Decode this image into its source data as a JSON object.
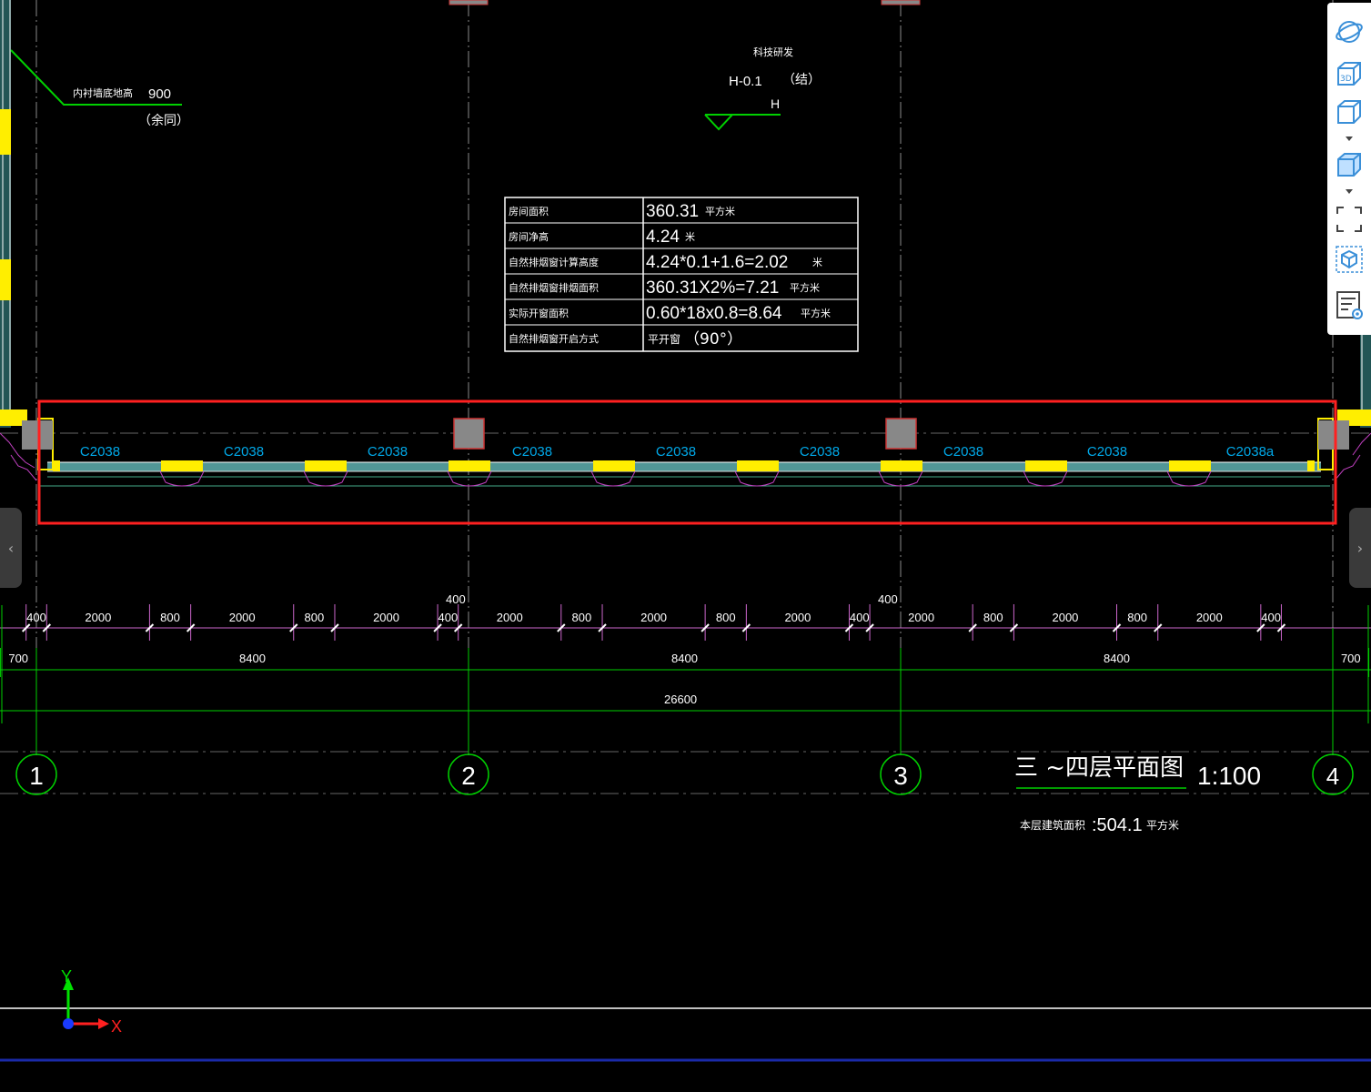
{
  "drawing": {
    "elevation": {
      "label": "科技研发",
      "value": "H-0.1",
      "note": "（结）",
      "h": "H"
    },
    "wall_note": {
      "label": "内衬墙底地高",
      "value": "900",
      "note": "（余同）"
    },
    "table": {
      "rows": [
        {
          "label": "房间面积",
          "value": "360.31",
          "unit": "平方米"
        },
        {
          "label": "房间净高",
          "value": "4.24",
          "unit": "米"
        },
        {
          "label": "自然排烟窗计算高度",
          "value": "4.24*0.1+1.6=2.02",
          "unit": "米"
        },
        {
          "label": "自然排烟窗排烟面积",
          "value": "360.31X2%=7.21",
          "unit": "平方米"
        },
        {
          "label": "实际开窗面积",
          "value": "0.60*18x0.8=8.64",
          "unit": "平方米"
        },
        {
          "label": "自然排烟窗开启方式",
          "value": "平开窗",
          "unit": "（90°）"
        }
      ]
    },
    "windows": [
      "C2038",
      "C2038",
      "C2038",
      "C2038",
      "C2038",
      "C2038",
      "C2038",
      "C2038",
      "C2038a"
    ],
    "dim_top_labels": [
      "400",
      "400"
    ],
    "dim_row1": [
      "400",
      "2000",
      "800",
      "2000",
      "800",
      "2000",
      "400",
      "2000",
      "800",
      "2000",
      "800",
      "2000",
      "400",
      "2000",
      "800",
      "2000",
      "800",
      "2000",
      "400"
    ],
    "dim_row2": [
      "700",
      "8400",
      "8400",
      "8400",
      "700"
    ],
    "dim_total": "26600",
    "axes": [
      "1",
      "2",
      "3",
      "4"
    ],
    "title": "三 ~四层平面图",
    "scale": "1:100",
    "area_label": "本层建筑面积",
    "area_value": ":504.1",
    "area_unit": "平方米",
    "ucs": {
      "x": "X",
      "y": "Y"
    }
  },
  "toolbar": {
    "items": [
      "orbit-icon",
      "view-3d-icon",
      "view-cube-icon",
      "shaded-cube-icon",
      "fullscreen-icon",
      "model-view-icon",
      "layer-view-icon"
    ]
  },
  "nav": {
    "prev": "‹",
    "next": "›"
  },
  "colors": {
    "highlight": "#ff2020",
    "dim_pink": "#cc66cc",
    "dim_green": "#00d000",
    "window_cyan": "#00a8e8",
    "wall_yellow": "#ffee00"
  }
}
